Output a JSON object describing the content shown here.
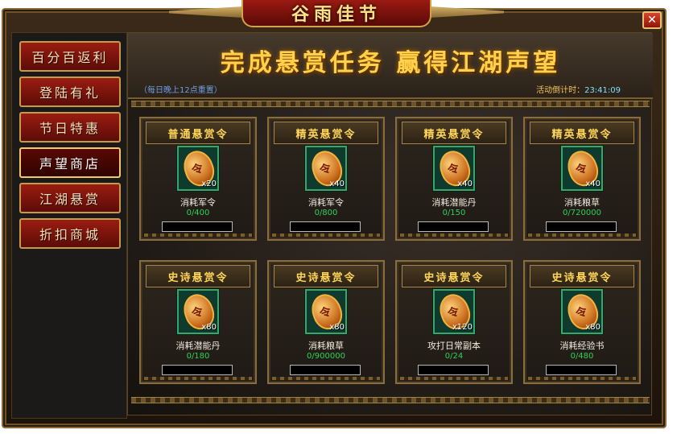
{
  "window": {
    "title": "谷雨佳节",
    "close_label": "✕",
    "accent": "#c69a4b",
    "tab_active_color": "#5a0803"
  },
  "sidebar": {
    "items": [
      {
        "label": "百分百返利"
      },
      {
        "label": "登陆有礼"
      },
      {
        "label": "节日特惠"
      },
      {
        "label": "声望商店"
      },
      {
        "label": "江湖悬赏"
      },
      {
        "label": "折扣商城"
      }
    ],
    "active_index": 3
  },
  "banner": {
    "title": "完成悬赏任务  赢得江湖声望",
    "reset_note": "（每日晚上12点重置）",
    "countdown_label": "活动倒计时：",
    "countdown_value": "23:41:09"
  },
  "cards": [
    {
      "title": "普通悬赏令",
      "icon": "bounty-token-icon",
      "count": "x20",
      "req_label": "消耗军令",
      "progress": "0/400"
    },
    {
      "title": "精英悬赏令",
      "icon": "bounty-token-icon",
      "count": "x40",
      "req_label": "消耗军令",
      "progress": "0/800"
    },
    {
      "title": "精英悬赏令",
      "icon": "bounty-token-icon",
      "count": "x40",
      "req_label": "消耗潜能丹",
      "progress": "0/150"
    },
    {
      "title": "精英悬赏令",
      "icon": "bounty-token-icon",
      "count": "x40",
      "req_label": "消耗粮草",
      "progress": "0/720000"
    },
    {
      "title": "史诗悬赏令",
      "icon": "bounty-token-icon",
      "count": "x80",
      "req_label": "消耗潜能丹",
      "progress": "0/180"
    },
    {
      "title": "史诗悬赏令",
      "icon": "bounty-token-icon",
      "count": "x80",
      "req_label": "消耗粮草",
      "progress": "0/900000"
    },
    {
      "title": "史诗悬赏令",
      "icon": "bounty-token-icon",
      "count": "x120",
      "req_label": "攻打日常副本",
      "progress": "0/24"
    },
    {
      "title": "史诗悬赏令",
      "icon": "bounty-token-icon",
      "count": "x80",
      "req_label": "消耗经验书",
      "progress": "0/480"
    }
  ]
}
